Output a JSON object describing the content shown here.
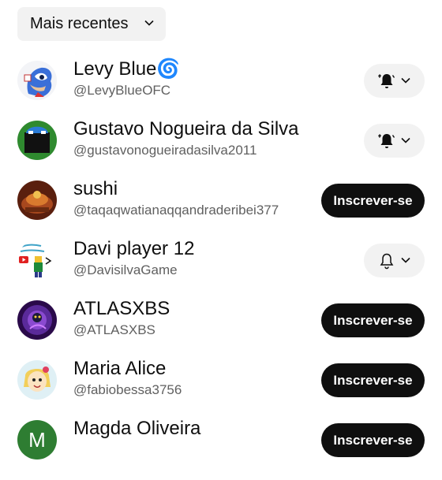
{
  "sort": {
    "label": "Mais recentes",
    "icon": "chevron-down-icon"
  },
  "subscribe_label": "Inscrever-se",
  "channels": [
    {
      "name": "Levy Blue",
      "name_emoji": "🌀",
      "handle": "@LevyBlueOFC",
      "state": "subscribed",
      "bell": "all-notifications",
      "avatar_color": "#3a6fd8"
    },
    {
      "name": "Gustavo Nogueira da Silva",
      "handle": "@gustavonogueiradasilva2011",
      "state": "subscribed",
      "bell": "all-notifications",
      "avatar_color": "#2f8a2f"
    },
    {
      "name": "sushi",
      "handle": "@taqaqwatianaqqandraderibei377",
      "state": "not-subscribed",
      "avatar_color": "#8a3a1a"
    },
    {
      "name": "Davi player 12",
      "handle": "@DavisilvaGame",
      "state": "subscribed",
      "bell": "personalized",
      "avatar_color": "#ffffff"
    },
    {
      "name": "ATLASXBS",
      "handle": "@ATLASXBS",
      "state": "not-subscribed",
      "avatar_color": "#4a1a8a"
    },
    {
      "name": "Maria Alice",
      "handle": "@fabiobessa3756",
      "state": "not-subscribed",
      "avatar_color": "#f5d98a"
    },
    {
      "name": "Magda Oliveira",
      "avatar_letter": "M",
      "state": "not-subscribed",
      "avatar_color": "#2e7d32"
    }
  ]
}
